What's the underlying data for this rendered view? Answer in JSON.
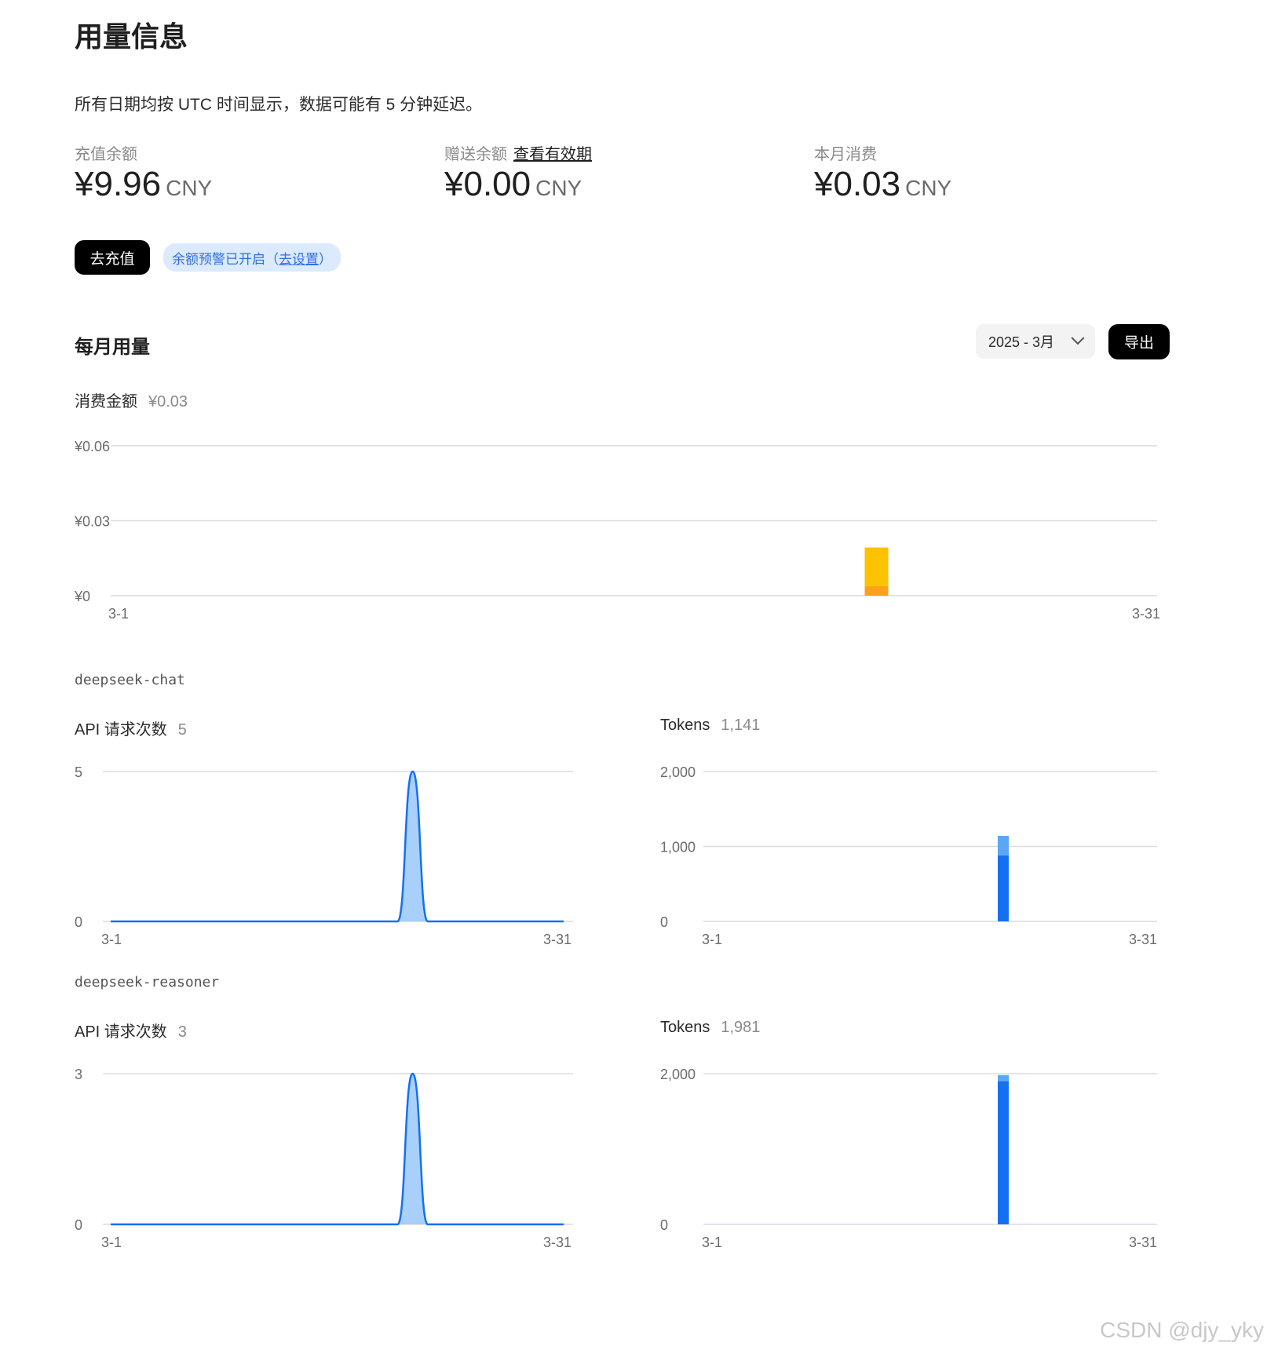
{
  "page": {
    "title": "用量信息",
    "notice": "所有日期均按 UTC 时间显示，数据可能有 5 分钟延迟。"
  },
  "balances": {
    "topup": {
      "label": "充值余额",
      "amount": "¥9.96",
      "currency": "CNY"
    },
    "gift": {
      "label": "赠送余额",
      "link": "查看有效期",
      "amount": "¥0.00",
      "currency": "CNY"
    },
    "month_spend": {
      "label": "本月消费",
      "amount": "¥0.03",
      "currency": "CNY"
    }
  },
  "actions": {
    "recharge": "去充值",
    "alert_text": "余额预警已开启（",
    "alert_link": "去设置",
    "alert_close": "）"
  },
  "monthly": {
    "title": "每月用量",
    "month_value": "2025 - 3月",
    "export_label": "导出",
    "spend_label": "消费金额",
    "spend_total": "¥0.03"
  },
  "models": [
    {
      "name": "deepseek-chat",
      "requests_label": "API 请求次数",
      "requests_total": "5",
      "tokens_label": "Tokens",
      "tokens_total": "1,141"
    },
    {
      "name": "deepseek-reasoner",
      "requests_label": "API 请求次数",
      "requests_total": "3",
      "tokens_label": "Tokens",
      "tokens_total": "1,981"
    }
  ],
  "colors": {
    "accent_blue": "#1570ef",
    "light_blue": "#5aa8f5",
    "fill_blue": "#9ecbfa",
    "gold": "#fdc200",
    "orange": "#fca119",
    "grid": "#d8dce6"
  },
  "watermark": "CSDN @djy_yky",
  "chart_data": [
    {
      "id": "spend",
      "type": "bar",
      "stacked": true,
      "x": [
        "3-1",
        "3-31"
      ],
      "x_range": [
        1,
        31
      ],
      "yticks": [
        "¥0",
        "¥0.03",
        "¥0.06"
      ],
      "ylim": [
        0,
        0.06
      ],
      "series": [
        {
          "points": [
            [
              23,
              0.0038
            ]
          ],
          "color": "#fca119"
        },
        {
          "points": [
            [
              23,
              0.0155
            ]
          ],
          "color": "#fdc200"
        }
      ]
    },
    {
      "id": "chat-requests",
      "type": "area",
      "x": [
        "3-1",
        "3-31"
      ],
      "x_range": [
        1,
        31
      ],
      "yticks": [
        "0",
        "5"
      ],
      "ylim": [
        0,
        5
      ],
      "series": [
        {
          "points": [
            [
              1,
              0
            ],
            [
              20,
              0
            ],
            [
              21,
              5
            ],
            [
              22,
              0
            ],
            [
              31,
              0
            ]
          ]
        }
      ]
    },
    {
      "id": "chat-tokens",
      "type": "bar",
      "stacked": true,
      "x": [
        "3-1",
        "3-31"
      ],
      "x_range": [
        1,
        31
      ],
      "yticks": [
        "0",
        "1,000",
        "2,000"
      ],
      "ylim": [
        0,
        2000
      ],
      "series": [
        {
          "points": [
            [
              21,
              880
            ]
          ],
          "color": "#1570ef"
        },
        {
          "points": [
            [
              21,
              261
            ]
          ],
          "color": "#5aa8f5"
        }
      ]
    },
    {
      "id": "reasoner-requests",
      "type": "area",
      "x": [
        "3-1",
        "3-31"
      ],
      "x_range": [
        1,
        31
      ],
      "yticks": [
        "0",
        "3"
      ],
      "ylim": [
        0,
        3
      ],
      "series": [
        {
          "points": [
            [
              1,
              0
            ],
            [
              20,
              0
            ],
            [
              21,
              3
            ],
            [
              22,
              0
            ],
            [
              31,
              0
            ]
          ]
        }
      ]
    },
    {
      "id": "reasoner-tokens",
      "type": "bar",
      "stacked": true,
      "x": [
        "3-1",
        "3-31"
      ],
      "x_range": [
        1,
        31
      ],
      "yticks": [
        "0",
        "2,000"
      ],
      "ylim": [
        0,
        2000
      ],
      "series": [
        {
          "points": [
            [
              21,
              1900
            ]
          ],
          "color": "#1570ef"
        },
        {
          "points": [
            [
              21,
              81
            ]
          ],
          "color": "#5aa8f5"
        }
      ]
    }
  ]
}
